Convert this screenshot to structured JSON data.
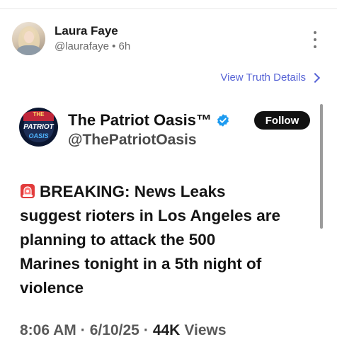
{
  "poster": {
    "name": "Laura Faye",
    "handle": "@laurafaye",
    "separator": "•",
    "time": "6h"
  },
  "view_details_label": "View Truth Details",
  "embedded": {
    "avatar_text": [
      "THE",
      "PATRIOT",
      "OASIS"
    ],
    "account_name": "The Patriot Oasis™",
    "handle": "@ThePatriotOasis",
    "follow_label": "Follow",
    "text_prefix_icon": "police-siren-emoji",
    "text_line_1": "BREAKING: News Leaks",
    "text_line_2": "suggest rioters in Los Angeles are",
    "text_line_3": "planning to attack the 500",
    "text_line_4": "Marines tonight in a 5th night of",
    "text_line_5": "violence",
    "time": "8:06 AM",
    "date": "6/10/25",
    "views_count": "44K",
    "views_label": "Views",
    "dot": "·"
  },
  "colors": {
    "link": "#5865d6",
    "verified": "#1d9bf0",
    "follow_bg": "#111111"
  }
}
